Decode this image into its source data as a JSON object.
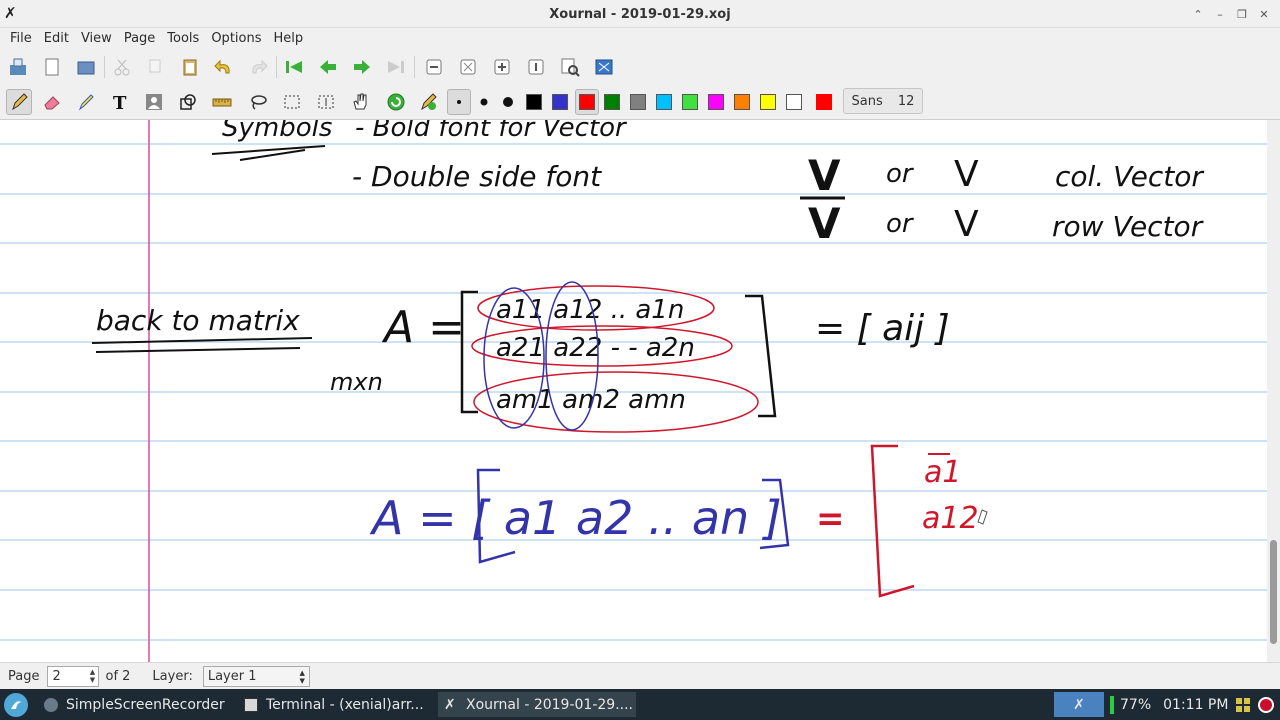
{
  "window": {
    "title": "Xournal - 2019-01-29.xoj"
  },
  "menu": {
    "items": [
      "File",
      "Edit",
      "View",
      "Page",
      "Tools",
      "Options",
      "Help"
    ]
  },
  "toolbar": {
    "font_name": "Sans",
    "font_size": "12",
    "colors": [
      "#000000",
      "#3333cc",
      "#ff0000",
      "#008000",
      "#808080",
      "#00c0ff",
      "#40e040",
      "#ff00ff",
      "#ff8000",
      "#ffff00",
      "#ffffff"
    ],
    "current_color": "#ff0000"
  },
  "status": {
    "page_label": "Page",
    "page_value": "2",
    "of_pages": "of 2",
    "layer_label": "Layer:",
    "layer_value": "Layer 1"
  },
  "taskbar": {
    "tasks": [
      "SimpleScreenRecorder",
      "Terminal - (xenial)arr...",
      "Xournal - 2019-01-29...."
    ],
    "battery": "77%",
    "clock": "01:11 PM"
  },
  "notes": {
    "line1": "- Bold font for Vector",
    "line2": "- Double side font",
    "symbols": "Symbols",
    "col_v": "V",
    "or": "or",
    "col_vector": "col. Vector",
    "row_vector": "row Vector",
    "back_to_matrix": "back to matrix",
    "a_eq": "A =",
    "mxn": "mxn",
    "r1": "a11  a12  ..  a1n",
    "r2": "a21  a22 - -  a2n",
    "r3": "am1  am2     amn",
    "aij": "= [ aij ]",
    "a_cols": "A = [ a1  a2  ..  an ]",
    "eq": "=",
    "a1": "a1",
    "a12": "a12"
  }
}
